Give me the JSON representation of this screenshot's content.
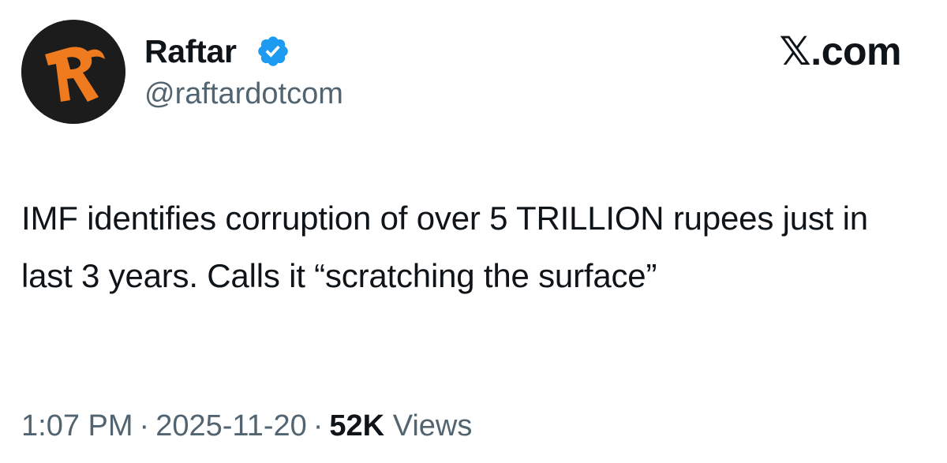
{
  "author": {
    "display_name": "Raftar",
    "handle": "@raftardotcom",
    "verified": true,
    "avatar_icon": "raftar-logo-icon",
    "avatar_bg_color": "#1c1c1c",
    "avatar_accent_color": "#f07a1e"
  },
  "brand": {
    "label": "𝕏.com"
  },
  "tweet": {
    "text": "IMF identifies corruption of over 5 TRILLION rupees just in last 3 years. Calls it “scratching the surface”"
  },
  "meta": {
    "time": "1:07 PM",
    "separator": "·",
    "date": "2025-11-20",
    "views_count": "52K",
    "views_label": "Views"
  },
  "colors": {
    "verified_badge": "#1d9bf0",
    "text_primary": "#0f1419",
    "text_secondary": "#536471"
  }
}
